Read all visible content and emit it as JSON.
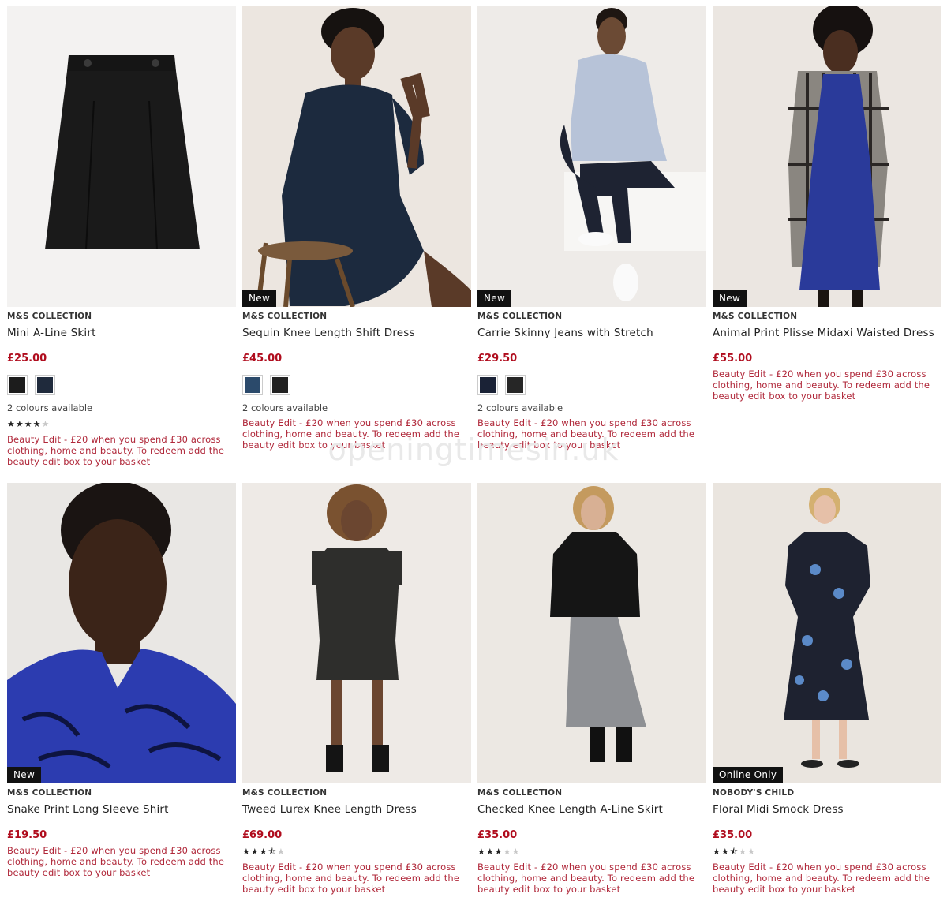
{
  "watermark": "openingtimesin.uk",
  "colors": {
    "price": "#b00d1e",
    "promo": "#b0283a",
    "badge_bg": "#111111"
  },
  "products": [
    {
      "brand": "M&S COLLECTION",
      "name": "Mini A-Line Skirt",
      "price": "£25.00",
      "badge": "",
      "swatches": [
        "#1c1c1c",
        "#1f2a3c"
      ],
      "colours": "2 colours available",
      "rating": 4,
      "promo": "Beauty Edit - £20 when you spend £30 across clothing, home and beauty. To redeem add the beauty edit box to your basket"
    },
    {
      "brand": "M&S COLLECTION",
      "name": "Sequin Knee Length Shift Dress",
      "price": "£45.00",
      "badge": "New",
      "swatches": [
        "#2b4a6b",
        "#222222"
      ],
      "colours": "2 colours available",
      "rating": 0,
      "promo": "Beauty Edit - £20 when you spend £30 across clothing, home and beauty. To redeem add the beauty edit box to your basket"
    },
    {
      "brand": "M&S COLLECTION",
      "name": "Carrie Skinny Jeans with Stretch",
      "price": "£29.50",
      "badge": "New",
      "swatches": [
        "#1a2236",
        "#262626"
      ],
      "colours": "2 colours available",
      "rating": 0,
      "promo": "Beauty Edit - £20 when you spend £30 across clothing, home and beauty. To redeem add the beauty edit box to your basket"
    },
    {
      "brand": "M&S COLLECTION",
      "name": "Animal Print Plisse Midaxi Waisted Dress",
      "price": "£55.00",
      "badge": "New",
      "swatches": [],
      "colours": "",
      "rating": 0,
      "promo": "Beauty Edit - £20 when you spend £30 across clothing, home and beauty. To redeem add the beauty edit box to your basket"
    },
    {
      "brand": "M&S COLLECTION",
      "name": "Snake Print Long Sleeve Shirt",
      "price": "£19.50",
      "badge": "New",
      "swatches": [],
      "colours": "",
      "rating": 0,
      "promo": "Beauty Edit - £20 when you spend £30 across clothing, home and beauty. To redeem add the beauty edit box to your basket"
    },
    {
      "brand": "M&S COLLECTION",
      "name": "Tweed Lurex Knee Length Dress",
      "price": "£69.00",
      "badge": "",
      "swatches": [],
      "colours": "",
      "rating": 3.5,
      "promo": "Beauty Edit - £20 when you spend £30 across clothing, home and beauty. To redeem add the beauty edit box to your basket"
    },
    {
      "brand": "M&S COLLECTION",
      "name": "Checked Knee Length A-Line Skirt",
      "price": "£35.00",
      "badge": "",
      "swatches": [],
      "colours": "",
      "rating": 3,
      "promo": "Beauty Edit - £20 when you spend £30 across clothing, home and beauty. To redeem add the beauty edit box to your basket"
    },
    {
      "brand": "NOBODY'S CHILD",
      "name": "Floral Midi Smock Dress",
      "price": "£35.00",
      "badge": "Online Only",
      "swatches": [],
      "colours": "",
      "rating": 2.5,
      "promo": "Beauty Edit - £20 when you spend £30 across clothing, home and beauty. To redeem add the beauty edit box to your basket"
    }
  ]
}
